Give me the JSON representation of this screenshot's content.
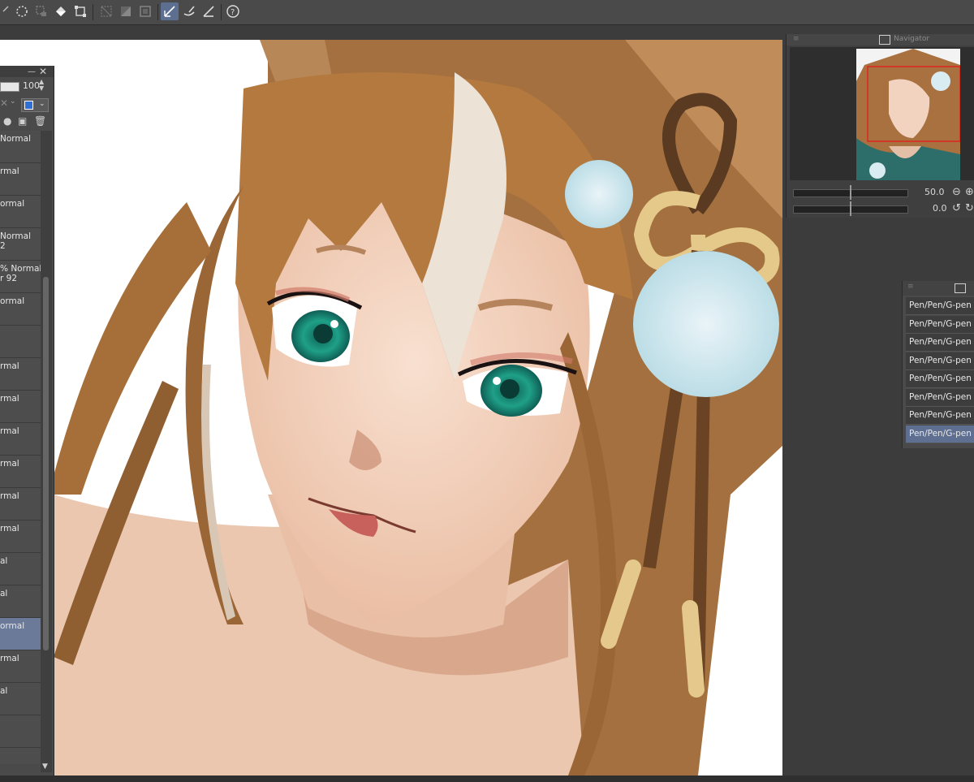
{
  "toolbar": {
    "icons": [
      "lasso-selection-icon",
      "magic-wand-icon",
      "selection-launcher-icon",
      "fill-icon",
      "transform-icon",
      "clear-outside-icon",
      "fill-selection-icon",
      "invert-selection-icon",
      "vector-pen-icon",
      "brush-correction-icon",
      "ruler-icon",
      "help-icon"
    ],
    "active": "vector-pen-icon"
  },
  "layer_panel": {
    "minimize_glyph": "—",
    "close_glyph": "✕",
    "opacity_value": "100",
    "layers": [
      {
        "blend": "Normal",
        "blend2": ""
      },
      {
        "blend": "rmal",
        "blend2": ""
      },
      {
        "blend": "ormal",
        "blend2": ""
      },
      {
        "blend": "Normal",
        "blend2": "2"
      },
      {
        "blend": "% Normal",
        "blend2": "r 92"
      },
      {
        "blend": "ormal",
        "blend2": ""
      },
      {
        "blend": "",
        "blend2": ""
      },
      {
        "blend": "rmal",
        "blend2": ""
      },
      {
        "blend": "rmal",
        "blend2": ""
      },
      {
        "blend": "rmal",
        "blend2": ""
      },
      {
        "blend": "rmal",
        "blend2": ""
      },
      {
        "blend": "rmal",
        "blend2": ""
      },
      {
        "blend": "rmal",
        "blend2": ""
      },
      {
        "blend": "al",
        "blend2": ""
      },
      {
        "blend": "al",
        "blend2": ""
      },
      {
        "blend": "ormal",
        "blend2": ""
      },
      {
        "blend": "rmal",
        "blend2": ""
      },
      {
        "blend": "al",
        "blend2": ""
      },
      {
        "blend": "",
        "blend2": ""
      },
      {
        "blend": "",
        "blend2": ""
      }
    ],
    "selected_index": 15
  },
  "navigator": {
    "title": "Navigator",
    "zoom_value": "50.0",
    "rotate_value": "0.0"
  },
  "brush_panel": {
    "items": [
      "Pen/Pen/G-pen",
      "Pen/Pen/G-pen",
      "Pen/Pen/G-pen",
      "Pen/Pen/G-pen",
      "Pen/Pen/G-pen",
      "Pen/Pen/G-pen",
      "Pen/Pen/G-pen",
      "Pen/Pen/G-pen"
    ],
    "selected_index": 7
  },
  "colors": {
    "accent": "#5e6f92",
    "hair": "#a8713f",
    "skin": "#f2d3c0",
    "eye": "#1f9e86",
    "pompom": "#d8ecf2",
    "ribbon": "#e5c98c"
  }
}
